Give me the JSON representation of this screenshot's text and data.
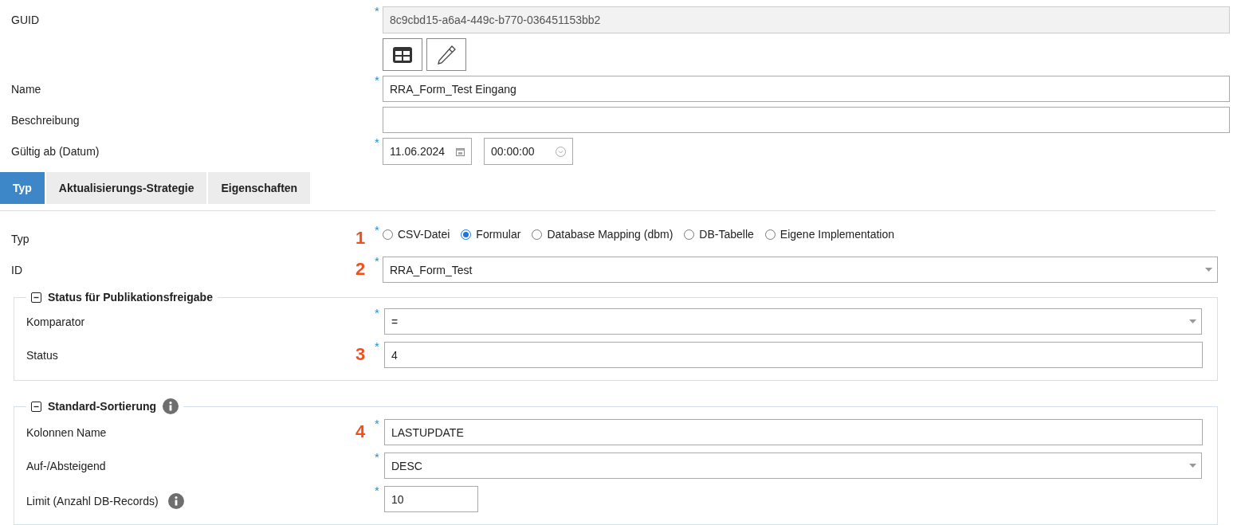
{
  "top_fields": [
    {
      "kind": "readonly",
      "label": "GUID",
      "required": "*",
      "value": "8c9cbd15-a6a4-449c-b770-036451153bb2"
    },
    {
      "kind": "tools"
    },
    {
      "kind": "text",
      "label": "Name",
      "required": "*",
      "value": "RRA_Form_Test Eingang"
    },
    {
      "kind": "text",
      "label": "Beschreibung"
    },
    {
      "kind": "datetime",
      "label": "Gültig ab (Datum)",
      "required": "*",
      "date": "11.06.2024",
      "time": "00:00:00"
    }
  ],
  "tabs": [
    {
      "label": "Typ",
      "selected": true
    },
    {
      "label": "Aktualisierungs-Strategie",
      "selected": false
    },
    {
      "label": "Eigenschaften",
      "selected": false
    }
  ],
  "tab_fields": [
    {
      "kind": "radio",
      "label": "Typ",
      "required": "*",
      "marker": "1",
      "options": [
        {
          "label": "CSV-Datei",
          "selected": false
        },
        {
          "label": "Formular",
          "selected": true
        },
        {
          "label": "Database Mapping (dbm)",
          "selected": false
        },
        {
          "label": "DB-Tabelle",
          "selected": false
        },
        {
          "label": "Eigene Implementation",
          "selected": false
        }
      ]
    },
    {
      "kind": "select",
      "label": "ID",
      "required": "*",
      "marker": "2",
      "value": "RRA_Form_Test"
    }
  ],
  "fieldsets": [
    {
      "title": "Status für Publikationsfreigabe",
      "expanded": true,
      "fields": [
        {
          "kind": "select",
          "label": "Komparator",
          "required": "*",
          "value": "="
        },
        {
          "kind": "text",
          "label": "Status",
          "required": "*",
          "marker": "3",
          "value": "4"
        }
      ]
    },
    {
      "title": "Standard-Sortierung",
      "expanded": true,
      "info": true,
      "fields": [
        {
          "kind": "text",
          "label": "Kolonnen Name",
          "required": "*",
          "marker": "4",
          "value": "LASTUPDATE"
        },
        {
          "kind": "select",
          "label": "Auf-/Absteigend",
          "required": "*",
          "value": "DESC"
        },
        {
          "kind": "short",
          "label": "Limit (Anzahl DB-Records)",
          "required": "*",
          "info": true,
          "value": "10"
        }
      ]
    }
  ]
}
